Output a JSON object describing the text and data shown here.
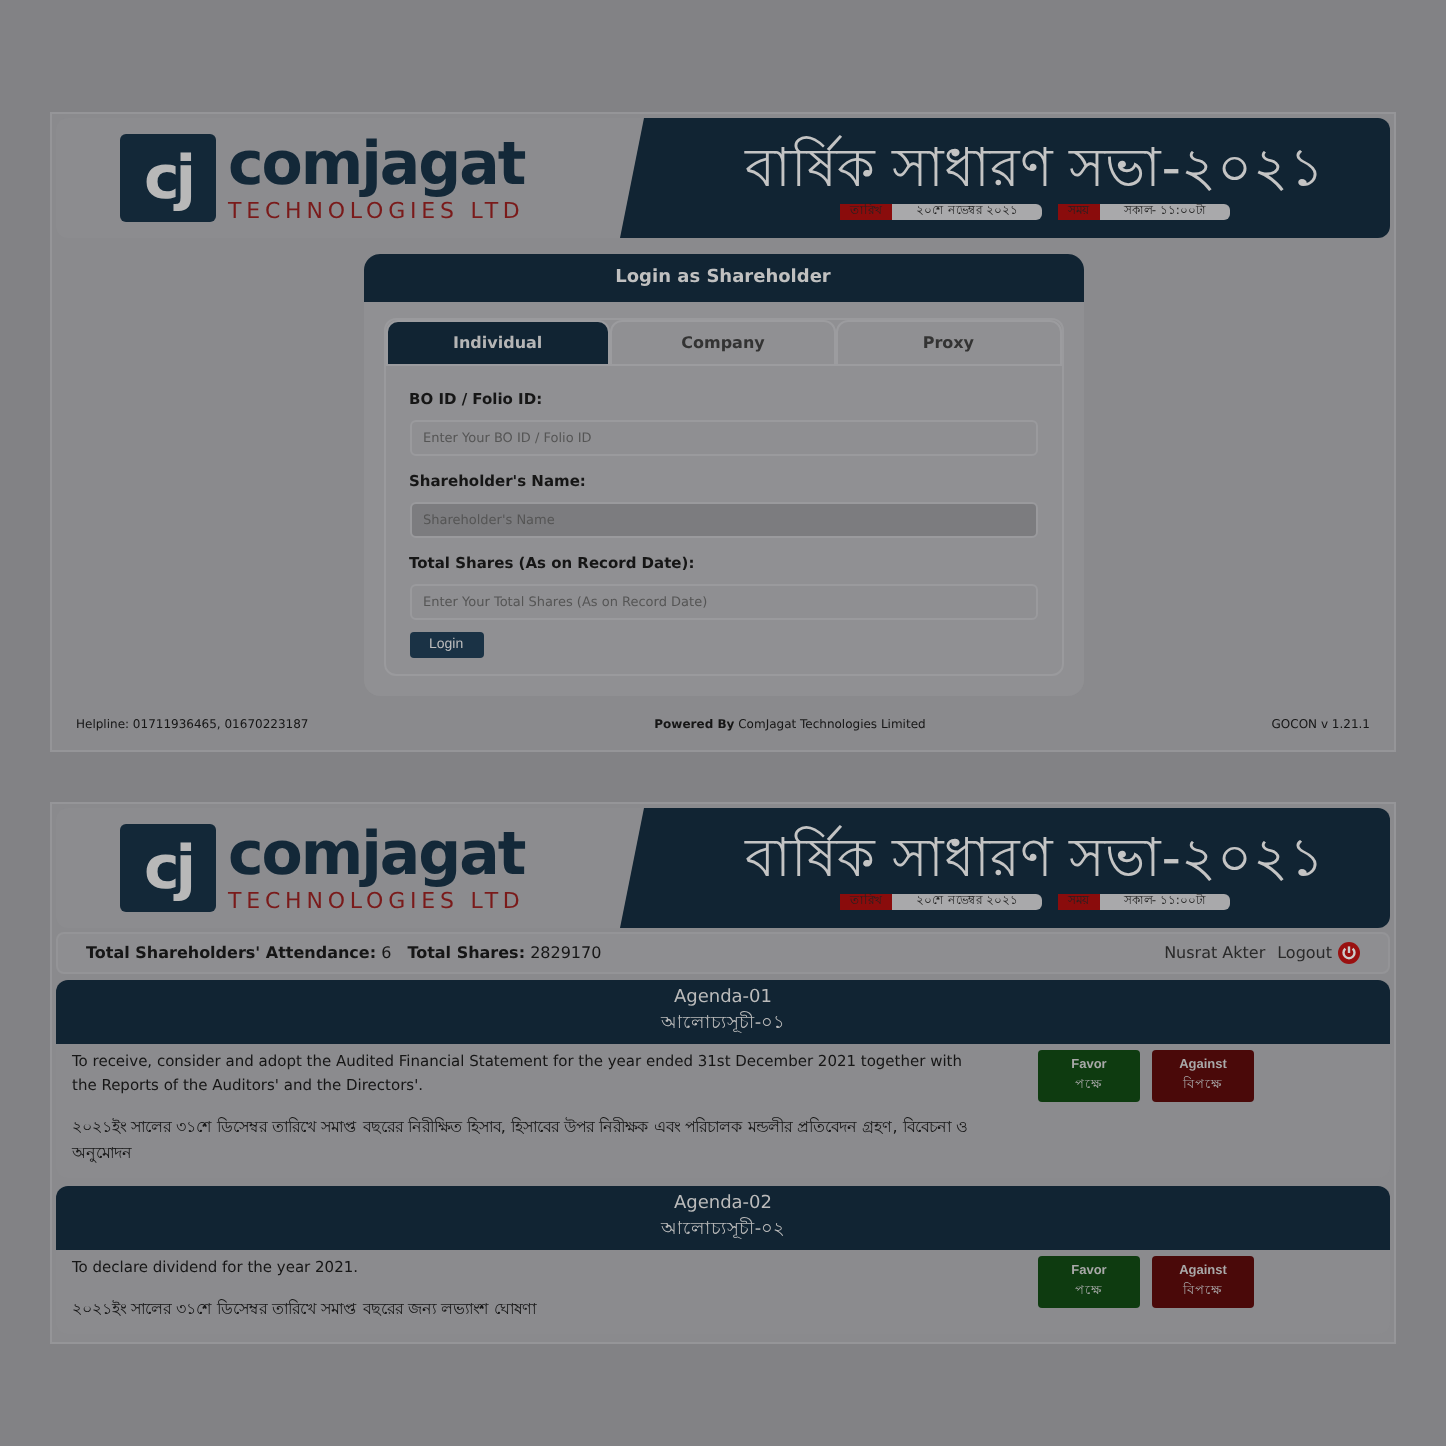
{
  "login_screen": {
    "header": {
      "logo_mark": "cj",
      "logo_name": "comjagat",
      "logo_tagline": "TECHNOLOGIES LTD",
      "title": "বার্ষিক সাধারণ সভা-২০২১",
      "badges": [
        {
          "label": "তারিখ",
          "value": "২০শে নভেম্বর ২০২১"
        },
        {
          "label": "সময়",
          "value": "সকাল- ১১:০০টা"
        }
      ]
    },
    "login": {
      "title": "Login as Shareholder",
      "tabs": [
        {
          "label": "Individual",
          "selected": true
        },
        {
          "label": "Company",
          "selected": false
        },
        {
          "label": "Proxy",
          "selected": false
        }
      ],
      "fields": [
        {
          "label": "BO ID / Folio ID:",
          "placeholder": "Enter Your BO ID / Folio ID",
          "disabled": false
        },
        {
          "label": "Shareholder's Name:",
          "placeholder": "Shareholder's Name",
          "disabled": true
        },
        {
          "label": "Total Shares (As on Record Date):",
          "placeholder": "Enter Your Total Shares (As on Record Date)",
          "disabled": false
        }
      ],
      "button": "Login"
    },
    "footer": {
      "helpline": "Helpline: 01711936465, 01670223187",
      "powered_label": "Powered By",
      "powered_text": "ComJagat Technologies Limited",
      "version": "GOCON v 1.21.1"
    }
  },
  "voting_screen": {
    "header": {
      "logo_mark": "cj",
      "logo_name": "comjagat",
      "logo_tagline": "TECHNOLOGIES LTD",
      "title": "বার্ষিক সাধারণ সভা-২০২১",
      "badges": [
        {
          "label": "তারিখ",
          "value": "২০শে নভেম্বর ২০২১"
        },
        {
          "label": "সময়",
          "value": "সকাল- ১১:০০টা"
        }
      ]
    },
    "stats": [
      {
        "label": "Total Shareholders' Attendance:",
        "value": "6"
      },
      {
        "label": "Total Shares:",
        "value": "2829170"
      }
    ],
    "user": "Nusrat Akter",
    "logout": "Logout",
    "agendas": [
      {
        "title": "Agenda-01",
        "title_bn": "আলোচ্যসূচী-০১",
        "text": "To receive, consider and adopt the Audited Financial Statement for the year ended 31st December 2021 together with the Reports of the Auditors' and the Directors'.",
        "text_bn": "২০২১ইং সালের ৩১শে ডিসেম্বর তারিখে সমাপ্ত বছরের নিরীক্ষিত হিসাব, হিসাবের উপর নিরীক্ষক এবং পরিচালক মন্ডলীর প্রতিবেদন গ্রহণ, বিবেচনা ও অনুমোদন",
        "buttons": [
          {
            "kind": "favor",
            "label": "Favor",
            "label_bn": "পক্ষে"
          },
          {
            "kind": "against",
            "label": "Against",
            "label_bn": "বিপক্ষে"
          }
        ]
      },
      {
        "title": "Agenda-02",
        "title_bn": "আলোচ্যসূচী-০২",
        "text": "To declare dividend for the year 2021.",
        "text_bn": "২০২১ইং সালের ৩১শে ডিসেম্বর তারিখে সমাপ্ত বছরের জন্য লভ্যাংশ ঘোষণা",
        "buttons": [
          {
            "kind": "favor",
            "label": "Favor",
            "label_bn": "পক্ষে"
          },
          {
            "kind": "against",
            "label": "Against",
            "label_bn": "বিপক্ষে"
          }
        ]
      }
    ]
  }
}
